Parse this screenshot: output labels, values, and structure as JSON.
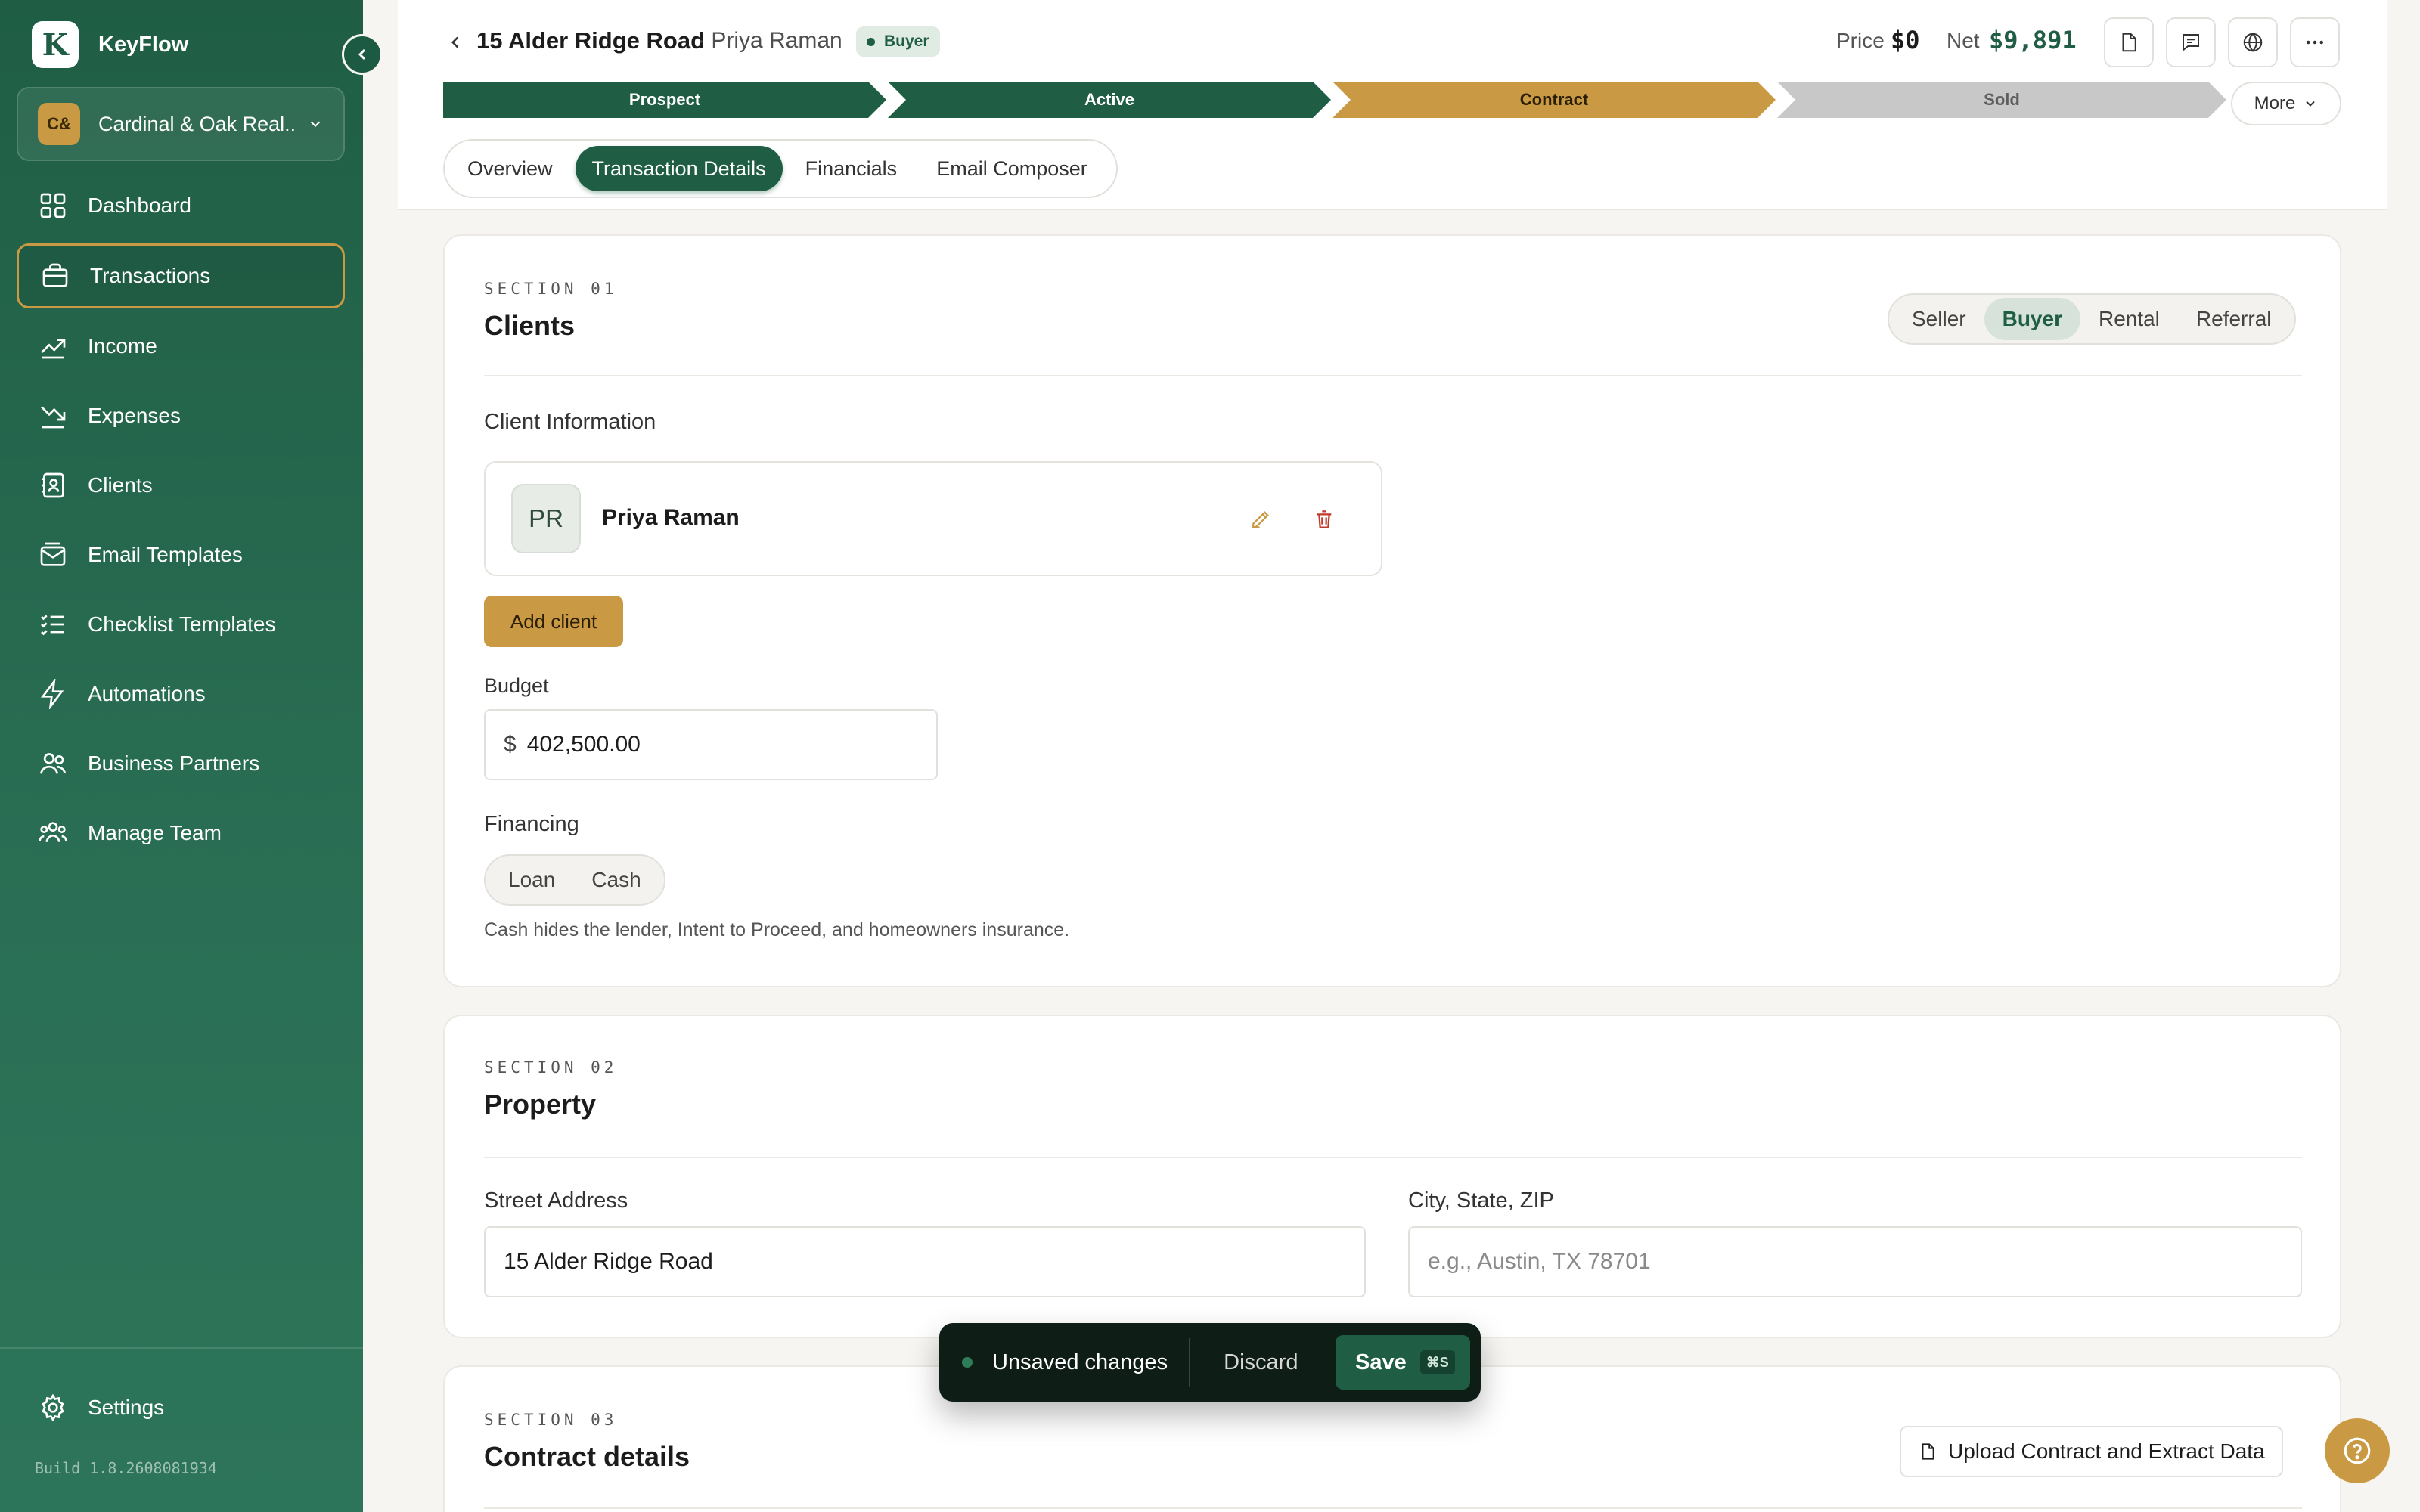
{
  "brand": {
    "logo_letter": "K",
    "name": "KeyFlow"
  },
  "org": {
    "badge": "C&",
    "name": "Cardinal & Oak Real.."
  },
  "nav": [
    {
      "label": "Dashboard",
      "icon": "grid-icon"
    },
    {
      "label": "Transactions",
      "icon": "briefcase-icon"
    },
    {
      "label": "Income",
      "icon": "trend-up-icon"
    },
    {
      "label": "Expenses",
      "icon": "trend-down-icon"
    },
    {
      "label": "Clients",
      "icon": "contacts-icon"
    },
    {
      "label": "Email Templates",
      "icon": "mail-icon"
    },
    {
      "label": "Checklist Templates",
      "icon": "checklist-icon"
    },
    {
      "label": "Automations",
      "icon": "bolt-icon"
    },
    {
      "label": "Business Partners",
      "icon": "partners-icon"
    },
    {
      "label": "Manage Team",
      "icon": "team-icon"
    }
  ],
  "settings_label": "Settings",
  "build": "Build 1.8.2608081934",
  "header": {
    "title": "15 Alder Ridge Road",
    "subtitle": "· Priya Raman",
    "role_badge": "Buyer",
    "price_label": "Price",
    "price_value": "$0",
    "net_label": "Net",
    "net_value": "$9,891"
  },
  "pipeline": [
    "Prospect",
    "Active",
    "Contract",
    "Sold"
  ],
  "more_label": "More",
  "tabs": [
    "Overview",
    "Transaction Details",
    "Financials",
    "Email Composer"
  ],
  "section1": {
    "label": "SECTION 01",
    "title": "Clients",
    "types": [
      "Seller",
      "Buyer",
      "Rental",
      "Referral"
    ],
    "client_info_label": "Client Information",
    "client": {
      "initials": "PR",
      "name": "Priya Raman"
    },
    "add_client": "Add client",
    "budget_label": "Budget",
    "budget_prefix": "$",
    "budget_value": "402,500.00",
    "financing_label": "Financing",
    "financing_options": [
      "Loan",
      "Cash"
    ],
    "financing_hint": "Cash hides the lender, Intent to Proceed, and homeowners insurance."
  },
  "section2": {
    "label": "SECTION 02",
    "title": "Property",
    "street_label": "Street Address",
    "street_value": "15 Alder Ridge Road",
    "city_label": "City, State, ZIP",
    "city_placeholder": "e.g., Austin, TX 78701"
  },
  "section3": {
    "label": "SECTION 03",
    "title": "Contract details",
    "upload_label": "Upload Contract and Extract Data"
  },
  "toast": {
    "message": "Unsaved changes",
    "discard": "Discard",
    "save": "Save",
    "shortcut": "⌘S"
  },
  "colors": {
    "primary": "#1f5e45",
    "accent_gold": "#c99a43",
    "stage_pending": "#c8c8c8"
  }
}
